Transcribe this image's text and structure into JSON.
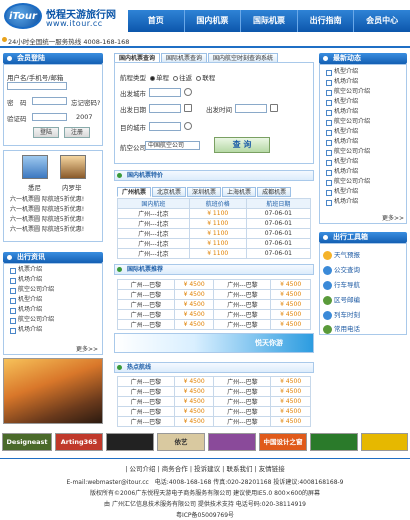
{
  "header": {
    "logo_mark": "iTour",
    "logo_cn": "悦程天游旅行网",
    "logo_url": "www.itour.cc",
    "hotline": "24小时全国统一服务热线 4008-168-168",
    "nav": [
      "首页",
      "国内机票",
      "国际机票",
      "出行指南",
      "会员中心"
    ]
  },
  "login": {
    "title": "会员登陆",
    "user_label": "用户名/手机号/邮箱",
    "password_label": "密　码",
    "forgot": "忘记密码?",
    "captcha_label": "验证码",
    "captcha_value": "2007",
    "login_btn": "登陆",
    "register_btn": "注册"
  },
  "destinations": {
    "items": [
      {
        "label": "悉尼"
      },
      {
        "label": "内罗毕"
      }
    ],
    "links": [
      "六一机票圆 际航班5折优惠!",
      "六一机票圆 际航班5折优惠!",
      "六一机票圆 际航班5折优惠!",
      "六一机票圆 际航班5折优惠!"
    ]
  },
  "news": {
    "title": "出行资讯",
    "items": [
      "机票介绍",
      "机场介绍",
      "航空公司介绍",
      "机型介绍",
      "机场介绍",
      "航空公司介绍",
      "机场介绍"
    ],
    "more": "更多>>"
  },
  "booking": {
    "tabs": [
      "国内机票查询",
      "国际机票查询",
      "国内航空时刻查询系统"
    ],
    "type_label": "航程类型",
    "types": [
      "单程",
      "往返",
      "联程"
    ],
    "from_label": "出发城市",
    "to_label": "到达城市",
    "date_label": "出发日期",
    "time_label": "出发时间",
    "dest_label": "目的城市",
    "airline_label": "航空公司",
    "airline_value": "中国航空公司",
    "search_btn": "查 询"
  },
  "fares": {
    "title": "国内机票特价",
    "tabs": [
      "广州机票",
      "北京机票",
      "深圳机票",
      "上海机票",
      "成都机票"
    ],
    "headers": [
      "国内航班",
      "航班价格",
      "航班日期"
    ],
    "rows": [
      [
        "广州---北京",
        "¥ 1100",
        "07-06-01"
      ],
      [
        "广州---北京",
        "¥ 1100",
        "07-06-01"
      ],
      [
        "广州---北京",
        "¥ 1100",
        "07-06-01"
      ],
      [
        "广州---北京",
        "¥ 1100",
        "07-06-01"
      ],
      [
        "广州---北京",
        "¥ 1100",
        "07-06-01"
      ]
    ]
  },
  "intl": {
    "title": "国际机票推荐",
    "rows": [
      [
        "广州---巴黎",
        "¥ 4500",
        "广州---巴黎",
        "¥ 4500"
      ],
      [
        "广州---巴黎",
        "¥ 4500",
        "广州---巴黎",
        "¥ 4500"
      ],
      [
        "广州---巴黎",
        "¥ 4500",
        "广州---巴黎",
        "¥ 4500"
      ],
      [
        "广州---巴黎",
        "¥ 4500",
        "广州---巴黎",
        "¥ 4500"
      ],
      [
        "广州---巴黎",
        "¥ 4500",
        "广州---巴黎",
        "¥ 4500"
      ]
    ],
    "banner": "悦天你游"
  },
  "hot": {
    "title": "热点航线",
    "rows": [
      [
        "广州---巴黎",
        "¥ 4500",
        "广州---巴黎",
        "¥ 4500"
      ],
      [
        "广州---巴黎",
        "¥ 4500",
        "广州---巴黎",
        "¥ 4500"
      ],
      [
        "广州---巴黎",
        "¥ 4500",
        "广州---巴黎",
        "¥ 4500"
      ],
      [
        "广州---巴黎",
        "¥ 4500",
        "广州---巴黎",
        "¥ 4500"
      ],
      [
        "广州---巴黎",
        "¥ 4500",
        "广州---巴黎",
        "¥ 4500"
      ]
    ]
  },
  "latest": {
    "title": "最新动态",
    "items": [
      "机型介绍",
      "机场介绍",
      "航空公司介绍",
      "机型介绍",
      "机场介绍",
      "航空公司介绍",
      "机型介绍",
      "机场介绍",
      "航空公司介绍",
      "机型介绍",
      "机场介绍",
      "航空公司介绍",
      "机型介绍",
      "机场介绍"
    ],
    "more": "更多>>"
  },
  "tools": {
    "title": "出行工具箱",
    "items": [
      "天气预报",
      "公交查询",
      "行车导航",
      "区号邮编",
      "列车时刻",
      "常用电话"
    ]
  },
  "ads": [
    "Designeast",
    "Arting365",
    "",
    "依艺",
    "",
    "中国设计之窗",
    ""
  ],
  "footer": {
    "links": "| 公司介绍 | 商务合作 | 投诉建议 | 联系我们 | 友情链接",
    "email": "E-mail:webmaster@itour.cc　电话:4008-168-168 传真:020-28201168 投诉建议:4008168168-9",
    "copyright": "版权所有©2006广东悦程天游电子商务服务有限公司 建议使用IE5.0 800×600的屏幕",
    "address": "由 广州汇亿信息技术服务有限公司 提供技术支持 电话号码:020-38114919",
    "icp": "粤ICP备05009769号"
  }
}
